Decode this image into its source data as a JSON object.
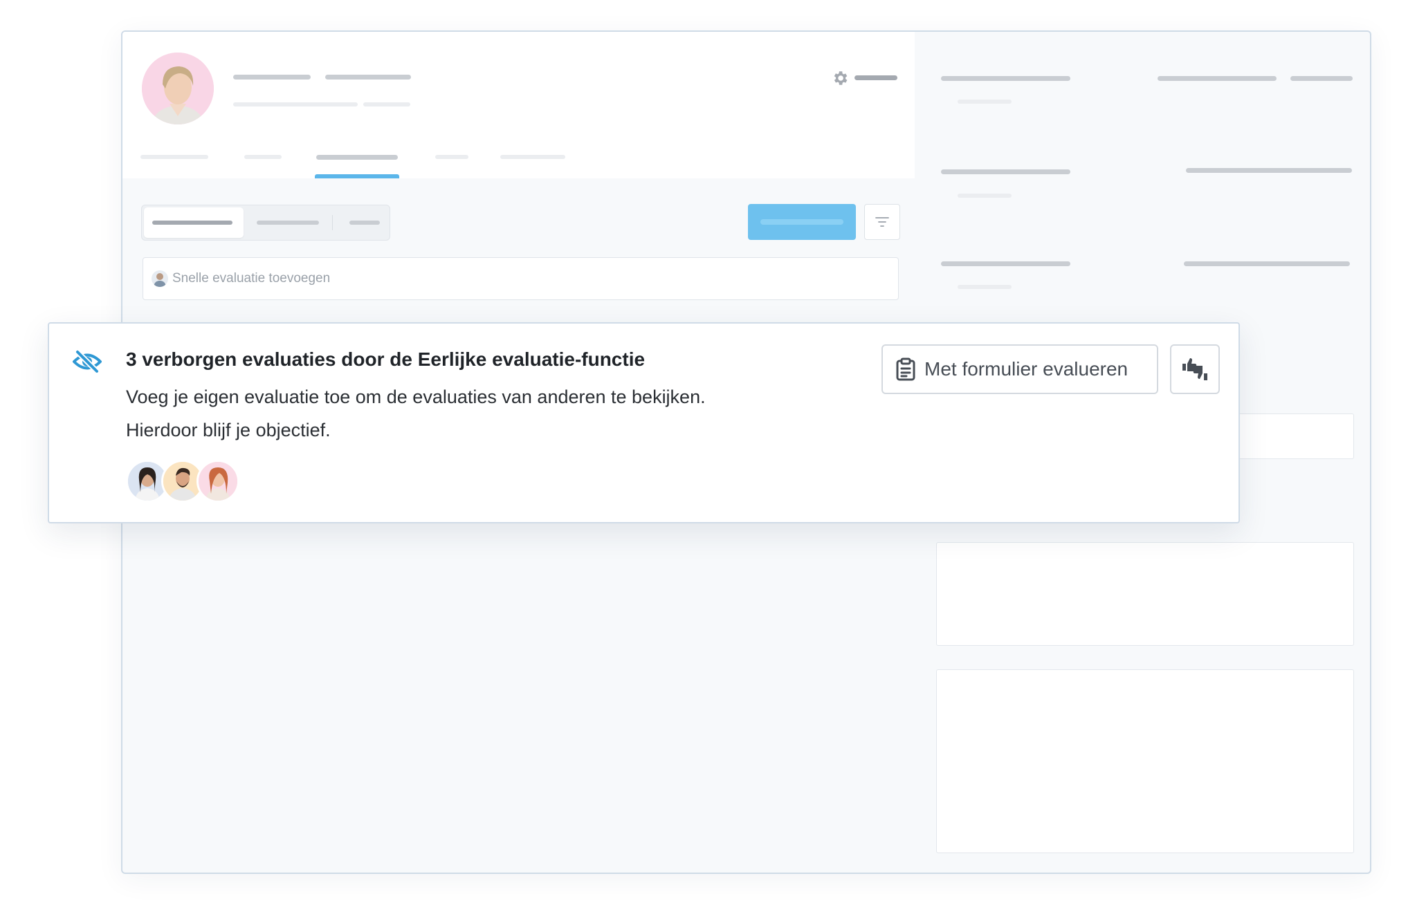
{
  "quick_eval": {
    "placeholder": "Snelle evaluatie toevoegen",
    "avatar_icon": "user-avatar-icon"
  },
  "notice": {
    "icon": "eye-slash-icon",
    "title": "3 verborgen evaluaties door de Eerlijke evaluatie-functie",
    "body": "Voeg je eigen evaluatie toe om de evaluaties van anderen te bekijken. Hierdoor blijf je objectief.",
    "reviewers": [
      {
        "icon": "reviewer-avatar-1",
        "bg": "#dbe4f2"
      },
      {
        "icon": "reviewer-avatar-2",
        "bg": "#fbe4c0"
      },
      {
        "icon": "reviewer-avatar-3",
        "bg": "#fadbe6"
      }
    ],
    "form_button": {
      "label": "Met formulier evalueren",
      "icon": "clipboard-icon"
    },
    "thumbs_button": {
      "icon": "thumbs-up-down-icon"
    }
  },
  "colors": {
    "accent": "#5bb6ea",
    "primary_button": "#6ec1ee",
    "notice_icon": "#2e98d4",
    "border": "#cfdbe7"
  }
}
